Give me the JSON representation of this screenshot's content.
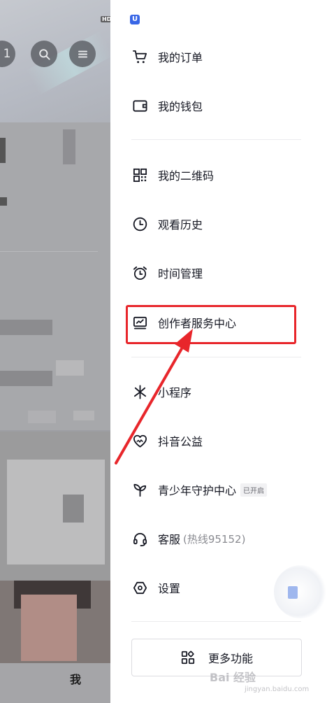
{
  "background_page": {
    "badge_text": "HD",
    "count_text": "1",
    "bottom_tab_me": "我"
  },
  "drawer": {
    "logo_text": "U",
    "items": [
      {
        "label": "我的订单",
        "icon": "cart-icon"
      },
      {
        "label": "我的钱包",
        "icon": "wallet-icon"
      },
      {
        "label": "我的二维码",
        "icon": "qr-code-icon"
      },
      {
        "label": "观看历史",
        "icon": "clock-icon"
      },
      {
        "label": "时间管理",
        "icon": "alarm-clock-icon"
      },
      {
        "label": "创作者服务中心",
        "icon": "chart-monitor-icon"
      },
      {
        "label": "小程序",
        "icon": "mini-program-icon"
      },
      {
        "label": "抖音公益",
        "icon": "charity-heart-icon"
      },
      {
        "label": "青少年守护中心",
        "icon": "sprout-icon",
        "badge": "已开启"
      },
      {
        "label": "客服",
        "hotline": "(热线95152)",
        "icon": "headset-icon"
      },
      {
        "label": "设置",
        "icon": "settings-hexagon-icon"
      }
    ],
    "more_button": {
      "label": "更多功能",
      "icon": "grid-apps-icon"
    }
  },
  "watermark": {
    "text": "Bai 经验",
    "url_text": "jingyan.baidu.com"
  },
  "colors": {
    "highlight": "#e8262b",
    "text": "#161823",
    "badge_bg": "#f1f1f3"
  }
}
